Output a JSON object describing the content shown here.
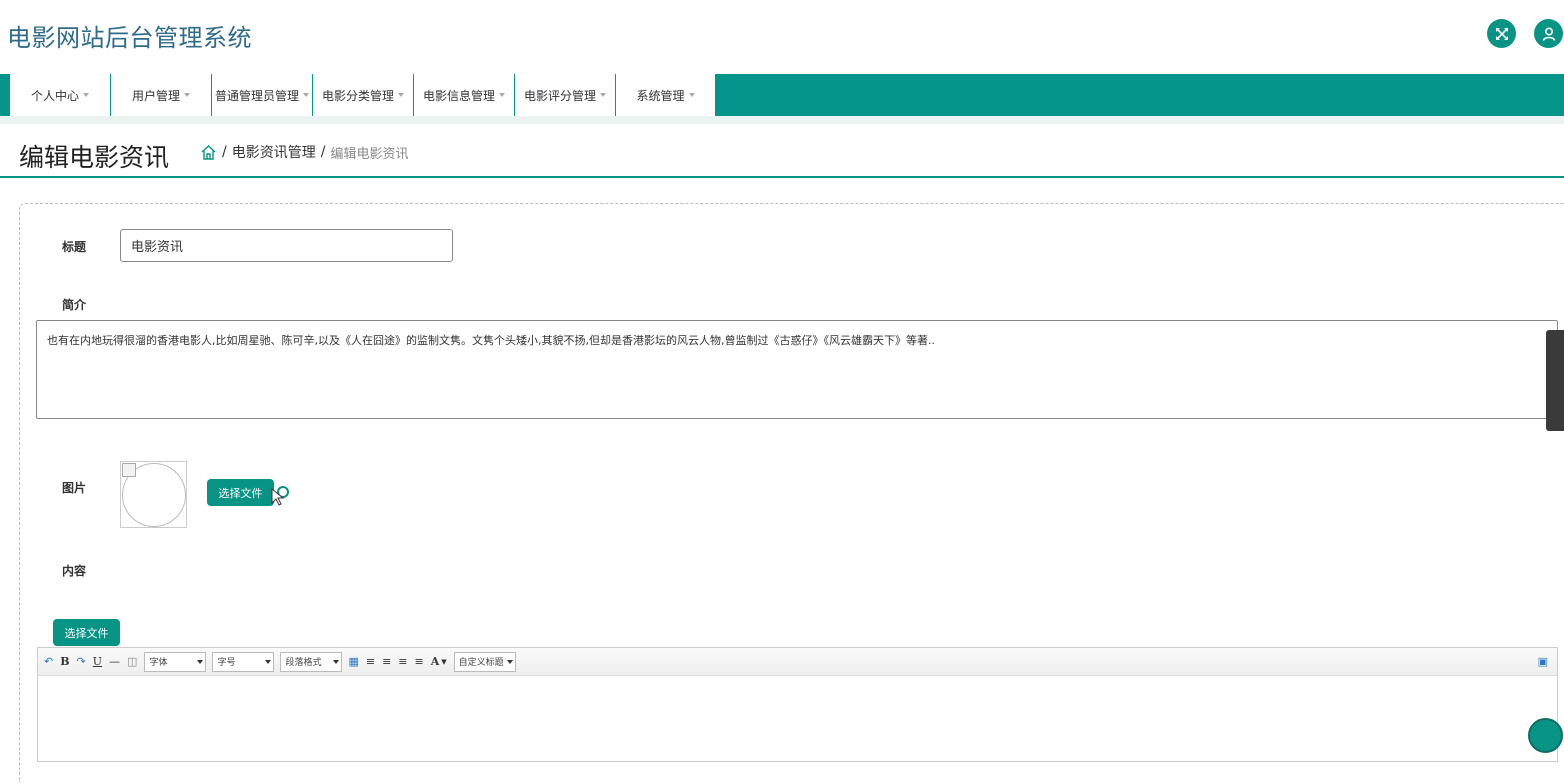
{
  "app": {
    "title": "电影网站后台管理系统"
  },
  "header_icons": [
    "fullscreen-icon",
    "user-icon"
  ],
  "nav": {
    "items": [
      {
        "label": "个人中心"
      },
      {
        "label": "用户管理"
      },
      {
        "label": "普通管理员管理"
      },
      {
        "label": "电影分类管理"
      },
      {
        "label": "电影信息管理"
      },
      {
        "label": "电影评分管理"
      },
      {
        "label": "系统管理"
      }
    ]
  },
  "page": {
    "title": "编辑电影资讯",
    "breadcrumb": {
      "sep1": "/",
      "section": "电影资讯管理",
      "sep2": "/",
      "current": "编辑电影资讯"
    }
  },
  "form": {
    "title_label": "标题",
    "title_value": "电影资讯",
    "intro_label": "简介",
    "intro_value": "也有在内地玩得很溜的香港电影人,比如周星驰、陈可辛,以及《人在囧途》的监制文隽。文隽个头矮小,其貌不扬,但却是香港影坛的风云人物,曾监制过《古惑仔》《风云雄霸天下》等著..",
    "image_label": "图片",
    "choose_file": "选择文件",
    "content_label": "内容",
    "content_choose_file": "选择文件"
  },
  "editor": {
    "font_family": "字体",
    "font_size": "字号",
    "paragraph": "段落格式",
    "custom_title": "自定义标题",
    "bold": "B",
    "underline": "U",
    "font_color": "A"
  },
  "colors": {
    "accent": "#079484",
    "title": "#2f6b8a"
  }
}
